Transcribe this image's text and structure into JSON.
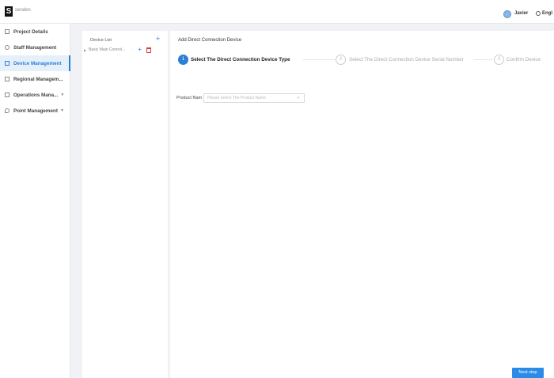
{
  "header": {
    "logo_letter": "S",
    "brand": "senden",
    "username": "Javier",
    "language": "Engl"
  },
  "sidebar": {
    "items": [
      {
        "label": "Project Details",
        "icon": "document-icon",
        "active": false,
        "has_chevron": false
      },
      {
        "label": "Staff Management",
        "icon": "person-icon",
        "active": false,
        "has_chevron": false
      },
      {
        "label": "Device Management",
        "icon": "device-icon",
        "active": true,
        "has_chevron": false
      },
      {
        "label": "Regional Managem...",
        "icon": "region-icon",
        "active": false,
        "has_chevron": false
      },
      {
        "label": "Operations Mana...",
        "icon": "operations-icon",
        "active": false,
        "has_chevron": true
      },
      {
        "label": "Point Management",
        "icon": "location-icon",
        "active": false,
        "has_chevron": true
      }
    ]
  },
  "device_tree": {
    "title": "Device List",
    "add_icon": "plus-icon",
    "nodes": [
      {
        "label": "Basic Main Control...",
        "more": "⋮"
      }
    ]
  },
  "main": {
    "title": "Add Direct Connection Device",
    "steps": [
      {
        "number": "1",
        "label": "Select The Direct Connection Device Type",
        "active": true
      },
      {
        "number": "2",
        "label": "Select The Direct Connection Device Serial Number",
        "active": false
      },
      {
        "number": "3",
        "label": "Confirm Device",
        "active": false
      }
    ],
    "product_field": {
      "label": "Product Nam",
      "placeholder": "Please Select The Product Name"
    },
    "next_button": "Next step"
  },
  "colors": {
    "accent": "#2b7fd6",
    "delete": "#e03b3b",
    "active_bg": "#e6f0fb"
  }
}
